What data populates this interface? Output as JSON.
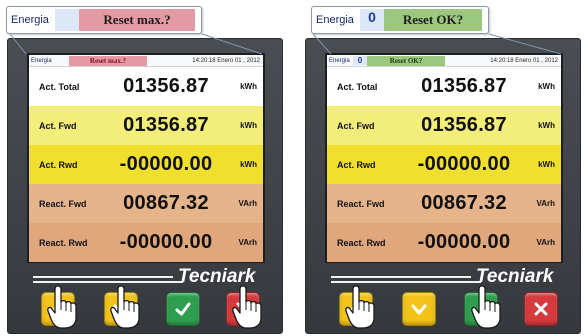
{
  "left": {
    "callout": {
      "mode": "Energia",
      "value": "",
      "message": "Reset max.?",
      "message_bg": "#e39aa4",
      "value_bg": "#dce8f7"
    },
    "status": {
      "mode": "Energia",
      "value": "",
      "message": "Reset max.?",
      "message_bg": "#e39aa4",
      "datetime": "14:20:18  Enero 01 , 2012"
    },
    "rows": [
      {
        "label": "Act. Total",
        "value": "01356.87",
        "unit": "kWh",
        "bg": "#ffffff"
      },
      {
        "label": "Act. Fwd",
        "value": "01356.87",
        "unit": "kWh",
        "bg": "#f3ee7a"
      },
      {
        "label": "Act. Rwd",
        "value": "-00000.00",
        "unit": "kWh",
        "bg": "#f1df2e"
      },
      {
        "label": "React. Fwd",
        "value": "00867.32",
        "unit": "VArh",
        "bg": "#e5b48a"
      },
      {
        "label": "React. Rwd",
        "value": "-00000.00",
        "unit": "VArh",
        "bg": "#e0a77d"
      }
    ],
    "brand": "Tecniark"
  },
  "right": {
    "callout": {
      "mode": "Energia",
      "value": "0",
      "message": "Reset OK?",
      "message_bg": "#9bc87e",
      "value_bg": "#dce8f7"
    },
    "status": {
      "mode": "Energia",
      "value": "0",
      "message": "Reset OK?",
      "message_bg": "#9bc87e",
      "datetime": "14:20:18  Enero 01 , 2012"
    },
    "rows": [
      {
        "label": "Act. Total",
        "value": "01356.87",
        "unit": "kWh",
        "bg": "#ffffff"
      },
      {
        "label": "Act. Fwd",
        "value": "01356.87",
        "unit": "kWh",
        "bg": "#f3ee7a"
      },
      {
        "label": "Act. Rwd",
        "value": "-00000.00",
        "unit": "kWh",
        "bg": "#f1df2e"
      },
      {
        "label": "React. Fwd",
        "value": "00867.32",
        "unit": "VArh",
        "bg": "#e5b48a"
      },
      {
        "label": "React. Rwd",
        "value": "-00000.00",
        "unit": "VArh",
        "bg": "#e0a77d"
      }
    ],
    "brand": "Tecniark"
  },
  "buttons": [
    {
      "name": "up-button",
      "icon": "chevron-up-icon",
      "color": "#f2c318"
    },
    {
      "name": "down-button",
      "icon": "chevron-down-icon",
      "color": "#f2c318"
    },
    {
      "name": "confirm-button",
      "icon": "check-icon",
      "color": "#2f9e4e"
    },
    {
      "name": "cancel-button",
      "icon": "close-icon",
      "color": "#d63a3c"
    }
  ]
}
